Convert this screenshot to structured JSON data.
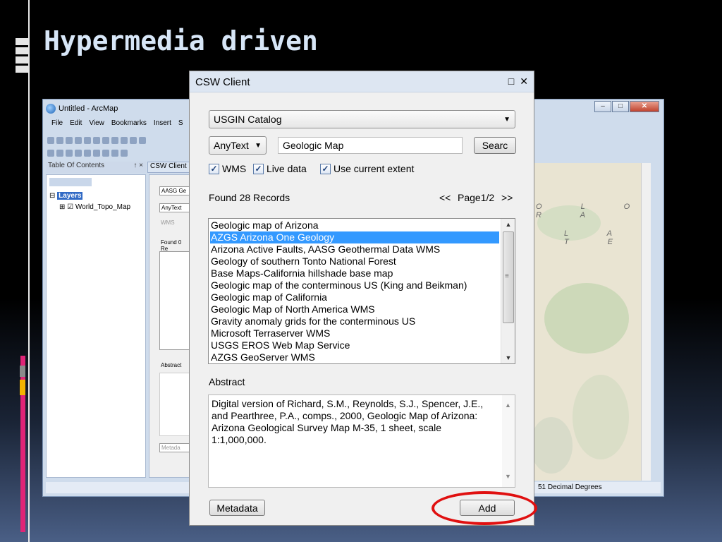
{
  "slide": {
    "title": "Hypermedia driven"
  },
  "arcmap": {
    "title": "Untitled - ArcMap",
    "menu": [
      "File",
      "Edit",
      "View",
      "Bookmarks",
      "Insert",
      "S"
    ],
    "toc_header": "Table Of Contents",
    "toc_pin": "↑ ×",
    "csw_tab": "CSW Client",
    "layers_label": "Layers",
    "layer_item": "World_Topo_Map",
    "csw_bg": {
      "catalog": "AASG Ge",
      "anytext": "AnyText",
      "wms": "WMS",
      "found": "Found 0 Re",
      "abstract": "Abstract",
      "metadata": "Metada"
    },
    "map_letters_1": "O L O R A",
    "map_letters_2": "L A T E",
    "status": "51 Decimal Degrees",
    "window_buttons": {
      "min": "–",
      "max": "□",
      "close": "✕"
    }
  },
  "dialog": {
    "title": "CSW Client",
    "title_icons": {
      "restore": "□",
      "close": "✕"
    },
    "catalog": {
      "value": "USGIN Catalog",
      "arrow": "▼"
    },
    "search_field": {
      "value": "AnyText",
      "arrow": "▼"
    },
    "search_text": "Geologic Map",
    "search_button": "Searc",
    "checkboxes": [
      {
        "label": "WMS",
        "checked": true
      },
      {
        "label": "Live data",
        "checked": true
      },
      {
        "label": "Use current extent",
        "checked": true
      }
    ],
    "check_mark": "✓",
    "found_text": "Found 28 Records",
    "pager": {
      "prev": "<<",
      "page": "Page1/2",
      "next": ">>"
    },
    "records": [
      "Geologic map of Arizona",
      "AZGS Arizona One Geology",
      "Arizona Active Faults, AASG Geothermal Data WMS",
      "Geology of southern Tonto National Forest",
      "Base Maps-California hillshade base map",
      "Geologic map of the conterminous US (King and Beikman)",
      "Geologic map of California",
      "Geologic Map of North America WMS",
      "Gravity anomaly grids for the conterminous US",
      "Microsoft Terraserver WMS",
      "USGS EROS Web Map Service",
      "AZGS GeoServer WMS"
    ],
    "selected_index": 1,
    "scroll_up": "▲",
    "scroll_down": "▼",
    "scroll_grip": "≡",
    "abstract_label": "Abstract",
    "abstract_text": "Digital version of Richard, S.M., Reynolds, S.J., Spencer, J.E., and Pearthree, P.A., comps., 2000, Geologic Map of Arizona: Arizona Geological Survey Map M-35, 1 sheet, scale 1:1,000,000.",
    "metadata_button": "Metadata",
    "add_button": "Add"
  },
  "colors": {
    "selection": "#3399ff",
    "highlight_ring": "#e01010",
    "title_text": "#d7e6f7"
  }
}
